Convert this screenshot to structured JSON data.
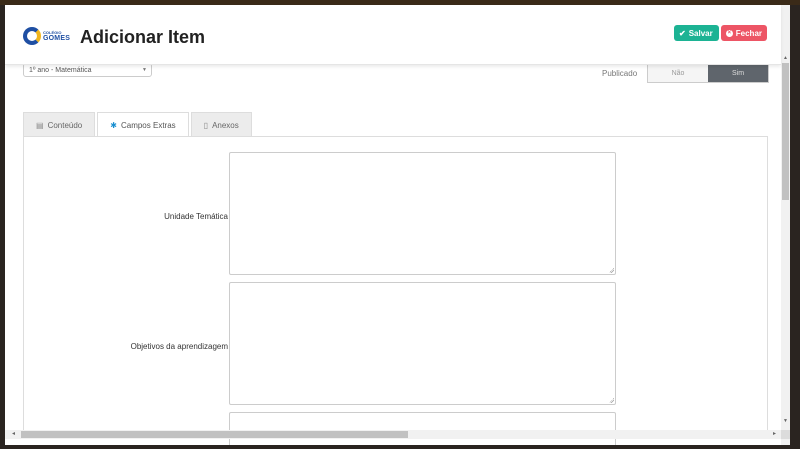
{
  "header": {
    "logo_small": "COLÉGIO",
    "logo_text": "GOMES",
    "title": "Adicionar Item",
    "save_label": "Salvar",
    "close_label": "Fechar"
  },
  "form": {
    "select_value": "1º ano - Matemática",
    "published_label": "Publicado",
    "toggle_no": "Não",
    "toggle_yes": "Sim",
    "toggle_selected": "Sim"
  },
  "tabs": [
    {
      "label": "Conteúdo",
      "icon": "document-icon"
    },
    {
      "label": "Campos Extras",
      "icon": "gear-icon"
    },
    {
      "label": "Anexos",
      "icon": "file-icon"
    }
  ],
  "active_tab": "Campos Extras",
  "fields": [
    {
      "label": "Unidade Temática",
      "value": ""
    },
    {
      "label": "Objetivos da aprendizagem",
      "value": ""
    }
  ],
  "colors": {
    "save": "#1cb394",
    "close": "#ed5565",
    "toggle_active": "#5f656c",
    "tab_icon_active": "#1a8fd0"
  }
}
